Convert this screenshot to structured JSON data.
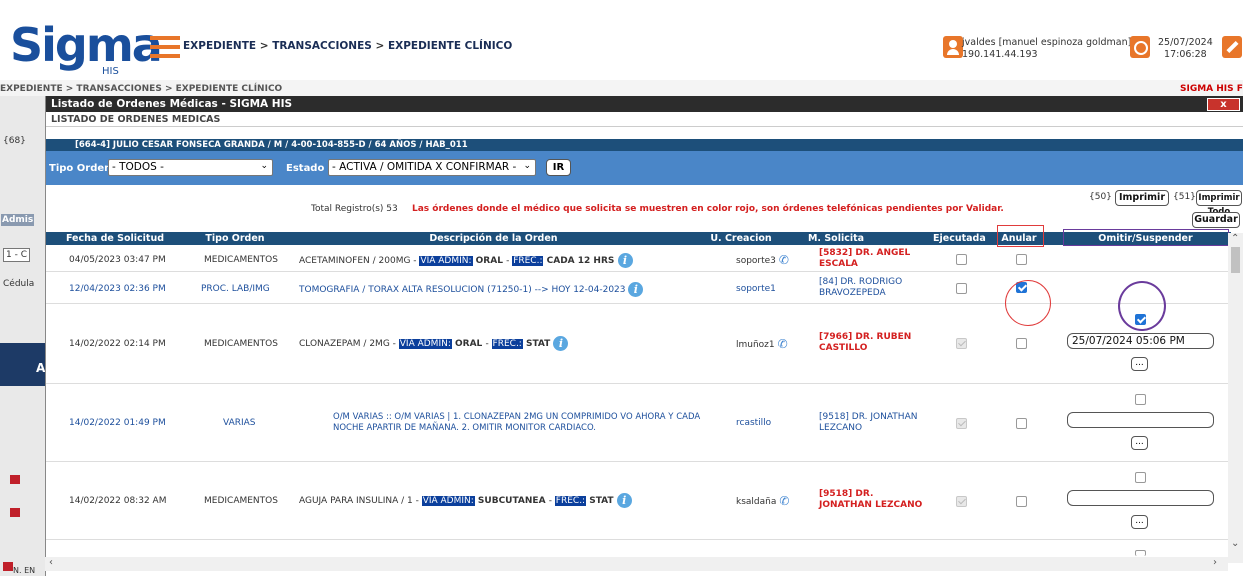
{
  "app": {
    "logo_text": "Sigma",
    "logo_sub": "HIS",
    "breadcrumb": [
      "EXPEDIENTE",
      "TRANSACCIONES",
      "EXPEDIENTE CLÍNICO"
    ],
    "user_line1": "jvaldes [manuel espinoza goldman] @",
    "user_line2": "190.141.44.193",
    "date": "25/07/2024",
    "time": "17:06:28",
    "icons": [
      "hamburger-icon",
      "user-icon",
      "clock-icon",
      "tools-icon"
    ],
    "accent_color": "#e8762a",
    "brand_color": "#1a4f9c"
  },
  "background": {
    "crumb": "EXPEDIENTE > TRANSACCIONES > EXPEDIENTE CLÍNICO",
    "right_crumb": "SIGMA HIS F",
    "left_labels": [
      "{68}",
      "Admis",
      "1 - C",
      "Cédula",
      "As",
      "N. EN"
    ]
  },
  "modal": {
    "title": "Listado de Ordenes Médicas - SIGMA HIS",
    "close_label": "x",
    "subtitle": "LISTADO DE ORDENES MEDICAS",
    "patient": "[664-4]  JULIO CESAR FONSECA GRANDA  / M / 4-00-104-855-D  / 64 AÑOS / HAB_011",
    "filters": {
      "tipo_label": "Tipo Orden",
      "tipo_value": "- TODOS -",
      "estado_label": "Estado",
      "estado_value": "- ACTIVA / OMITIDA X CONFIRMAR -",
      "ir_label": "IR"
    },
    "toolbar": {
      "code50": "{50}",
      "imprimir": "Imprimir",
      "code51": "{51}",
      "imprimir_todo": "Imprimir Todo",
      "guardar": "Guardar"
    },
    "total": "Total Registro(s) 53",
    "warning": "Las órdenes donde el médico que solicita se muestren en color rojo, son órdenes telefónicas pendientes por Validar.",
    "table": {
      "headers": [
        "Fecha de Solicitud",
        "Tipo Orden",
        "Descripción de la Orden",
        "U. Creacion",
        "M. Solicita",
        "Ejecutada",
        "Anular",
        "Omitir/Suspender"
      ],
      "rows": [
        {
          "fecha": "04/05/2023 03:47 PM",
          "tipo": "MEDICAMENTOS",
          "desc_a": "ACETAMINOFEN / 200MG  - ",
          "via_label": "VIA ADMIN:",
          "via": " ORAL ",
          "frec_label": "FREC.:",
          "frec": " CADA 12 HRS ",
          "usuario": "soporte3",
          "medico": "[5832] DR. ANGEL ESCALA",
          "medico_color": "red",
          "ejecutada": "unchecked",
          "anular": "unchecked",
          "omitir_date": "",
          "blue": false
        },
        {
          "fecha": "12/04/2023 02:36 PM",
          "tipo": "PROC. LAB/IMG",
          "desc_a": "TOMOGRAFIA / TORAX ALTA RESOLUCION (71250-1) --> HOY 12-04-2023 ",
          "usuario": "soporte1",
          "medico": "[84] DR. RODRIGO BRAVOZEPEDA",
          "medico_color": "blue",
          "ejecutada": "unchecked",
          "anular": "checked",
          "blue": true
        },
        {
          "fecha": "14/02/2022 02:14 PM",
          "tipo": "MEDICAMENTOS",
          "desc_a": "CLONAZEPAM / 2MG  - ",
          "via_label": "VIA ADMIN:",
          "via": " ORAL ",
          "frec_label": "FREC.:",
          "frec": " STAT ",
          "usuario": "lmuñoz1",
          "medico": "[7966] DR. RUBEN CASTILLO",
          "medico_color": "red",
          "ejecutada": "disabled",
          "anular": "unchecked",
          "omitir_checked": true,
          "omitir_date": "25/07/2024 05:06 PM",
          "ellipsis": "...",
          "blue": false
        },
        {
          "fecha": "14/02/2022 01:49 PM",
          "tipo": "VARIAS",
          "desc_a": "O/M VARIAS ::  O/M VARIAS  |  1. CLONAZEPAN 2MG UN COMPRIMIDO VO AHORA Y CADA NOCHE APARTIR DE MAÑANA. 2. OMITIR MONITOR CARDIACO.",
          "usuario": "rcastillo",
          "medico": "[9518] DR. JONATHAN LEZCANO",
          "medico_color": "blue",
          "ejecutada": "disabled",
          "anular": "unchecked",
          "omitir_checked": false,
          "omitir_date": "",
          "ellipsis": "...",
          "blue": true
        },
        {
          "fecha": "14/02/2022 08:32 AM",
          "tipo": "MEDICAMENTOS",
          "desc_a": "AGUJA PARA INSULINA / 1  - ",
          "via_label": "VIA ADMIN:",
          "via": " SUBCUTANEA ",
          "frec_label": "FREC.:",
          "frec": " STAT ",
          "usuario": "ksaldaña",
          "medico": "[9518] DR. JONATHAN LEZCANO",
          "medico_color": "red",
          "ejecutada": "disabled",
          "anular": "unchecked",
          "omitir_checked": false,
          "omitir_date": "",
          "ellipsis": "...",
          "blue": false
        }
      ]
    }
  }
}
